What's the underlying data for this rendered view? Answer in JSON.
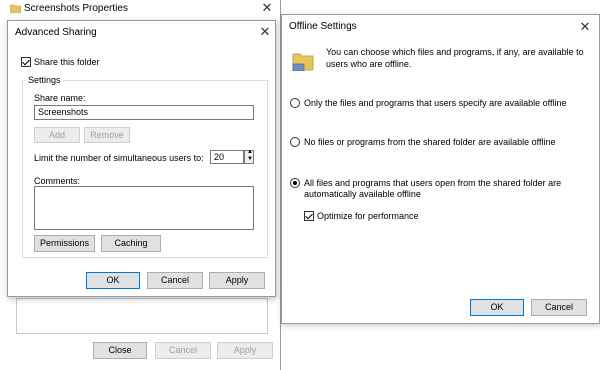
{
  "screenshots_props": {
    "title": "Screenshots Properties",
    "close_label": "Close",
    "cancel_label": "Cancel",
    "apply_label": "Apply"
  },
  "advanced_sharing": {
    "title": "Advanced Sharing",
    "share_checkbox_label": "Share this folder",
    "share_checked": true,
    "settings_group_label": "Settings",
    "share_name_label": "Share name:",
    "share_name_value": "Screenshots",
    "add_label": "Add",
    "remove_label": "Remove",
    "limit_label": "Limit the number of simultaneous users to:",
    "limit_value": "20",
    "comments_label": "Comments:",
    "comments_value": "",
    "permissions_label": "Permissions",
    "caching_label": "Caching",
    "ok_label": "OK",
    "cancel_label": "Cancel",
    "apply_label": "Apply"
  },
  "offline_settings": {
    "title": "Offline Settings",
    "description": "You can choose which files and programs, if any, are available to users who are offline.",
    "option1_label": "Only the files and programs that users specify are available offline",
    "option1_checked": false,
    "option2_label": "No files or programs from the shared folder are available offline",
    "option2_checked": false,
    "option3_label": "All files and programs that users open from the shared folder are automatically available offline",
    "option3_checked": true,
    "optimize_label": "Optimize for performance",
    "optimize_checked": true,
    "ok_label": "OK",
    "cancel_label": "Cancel"
  },
  "colors": {
    "accent_border": "#0078d7",
    "button_face": "#e1e1e1",
    "folder_yellow": "#e8c35a"
  }
}
